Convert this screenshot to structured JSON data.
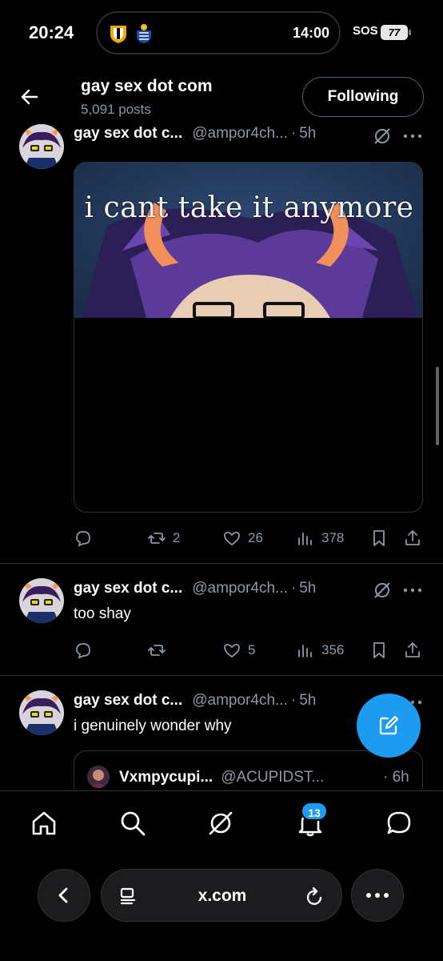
{
  "status_bar": {
    "clock": "20:24",
    "island_time": "14:00",
    "sos": "SOS",
    "battery": "77"
  },
  "header": {
    "title": "gay sex dot com",
    "subtitle": "5,091 posts",
    "follow_label": "Following"
  },
  "posts": [
    {
      "name": "gay sex dot c...",
      "handle": "@ampor4ch...",
      "separator": "·",
      "age": "5h",
      "media_caption": "i cant take it anymore",
      "stats": {
        "retweets": "2",
        "likes": "26",
        "views": "378"
      }
    },
    {
      "name": "gay sex dot c...",
      "handle": "@ampor4ch...",
      "separator": "·",
      "age": "5h",
      "text": "too shay",
      "stats": {
        "likes": "5",
        "views": "356"
      }
    },
    {
      "name": "gay sex dot c...",
      "handle": "@ampor4ch...",
      "separator": "·",
      "age": "5h",
      "text": "i genuinely wonder why",
      "quote": {
        "name": "Vxmpycupi...",
        "handle": "@ACUPIDST...",
        "age": "· 6h"
      }
    }
  ],
  "bottom_nav": {
    "notification_count": "13"
  },
  "browser": {
    "url": "x.com"
  },
  "colors": {
    "accent": "#1d9bf0",
    "muted_text": "#8b98a5",
    "divider": "#2f3336"
  }
}
